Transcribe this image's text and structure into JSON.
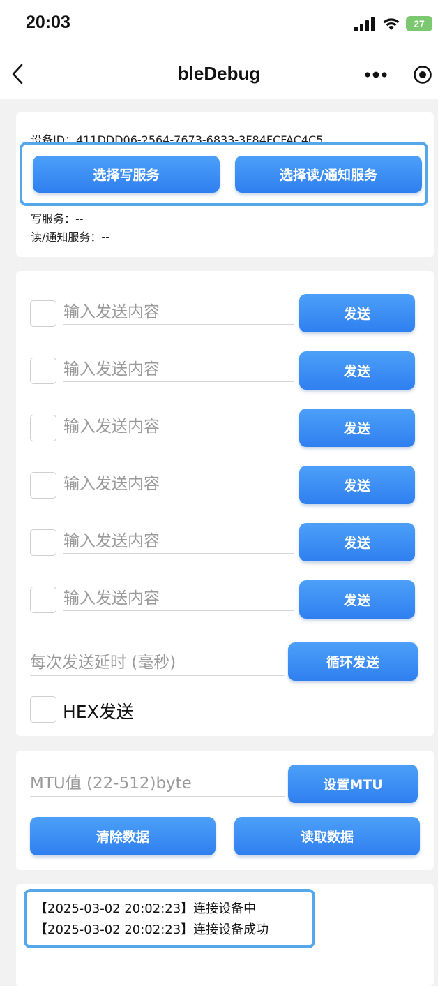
{
  "status_bar": {
    "time": "20:03",
    "battery": "27",
    "icons": [
      "signal-icon",
      "wifi-icon",
      "battery-charging-icon"
    ]
  },
  "nav": {
    "title": "bleDebug",
    "icons": [
      "back-icon",
      "more-icon",
      "target-icon"
    ]
  },
  "device": {
    "id_line": "设备ID：411DDD06-2564-7673-6833-3F84FCFAC4C5",
    "select_write_label": "选择写服务",
    "select_read_label": "选择读/通知服务",
    "write_service_line": "写服务：--",
    "read_service_line": "读/通知服务：--"
  },
  "send": {
    "rows": [
      {
        "placeholder": "输入发送内容",
        "button": "发送"
      },
      {
        "placeholder": "输入发送内容",
        "button": "发送"
      },
      {
        "placeholder": "输入发送内容",
        "button": "发送"
      },
      {
        "placeholder": "输入发送内容",
        "button": "发送"
      },
      {
        "placeholder": "输入发送内容",
        "button": "发送"
      },
      {
        "placeholder": "输入发送内容",
        "button": "发送"
      }
    ],
    "delay_placeholder": "每次发送延时 (毫秒)",
    "loop_label": "循环发送",
    "hex_label": "HEX发送"
  },
  "mtu": {
    "placeholder": "MTU值 (22-512)byte",
    "set_label": "设置MTU",
    "clear_label": "清除数据",
    "read_label": "读取数据"
  },
  "log": {
    "lines": [
      "【2025-03-02 20:02:23】连接设备中",
      "【2025-03-02 20:02:23】连接设备成功"
    ]
  },
  "colors": {
    "accent": "#3a8cf5",
    "highlight_border": "#54a8ea",
    "page_bg": "#f2f2f2"
  }
}
